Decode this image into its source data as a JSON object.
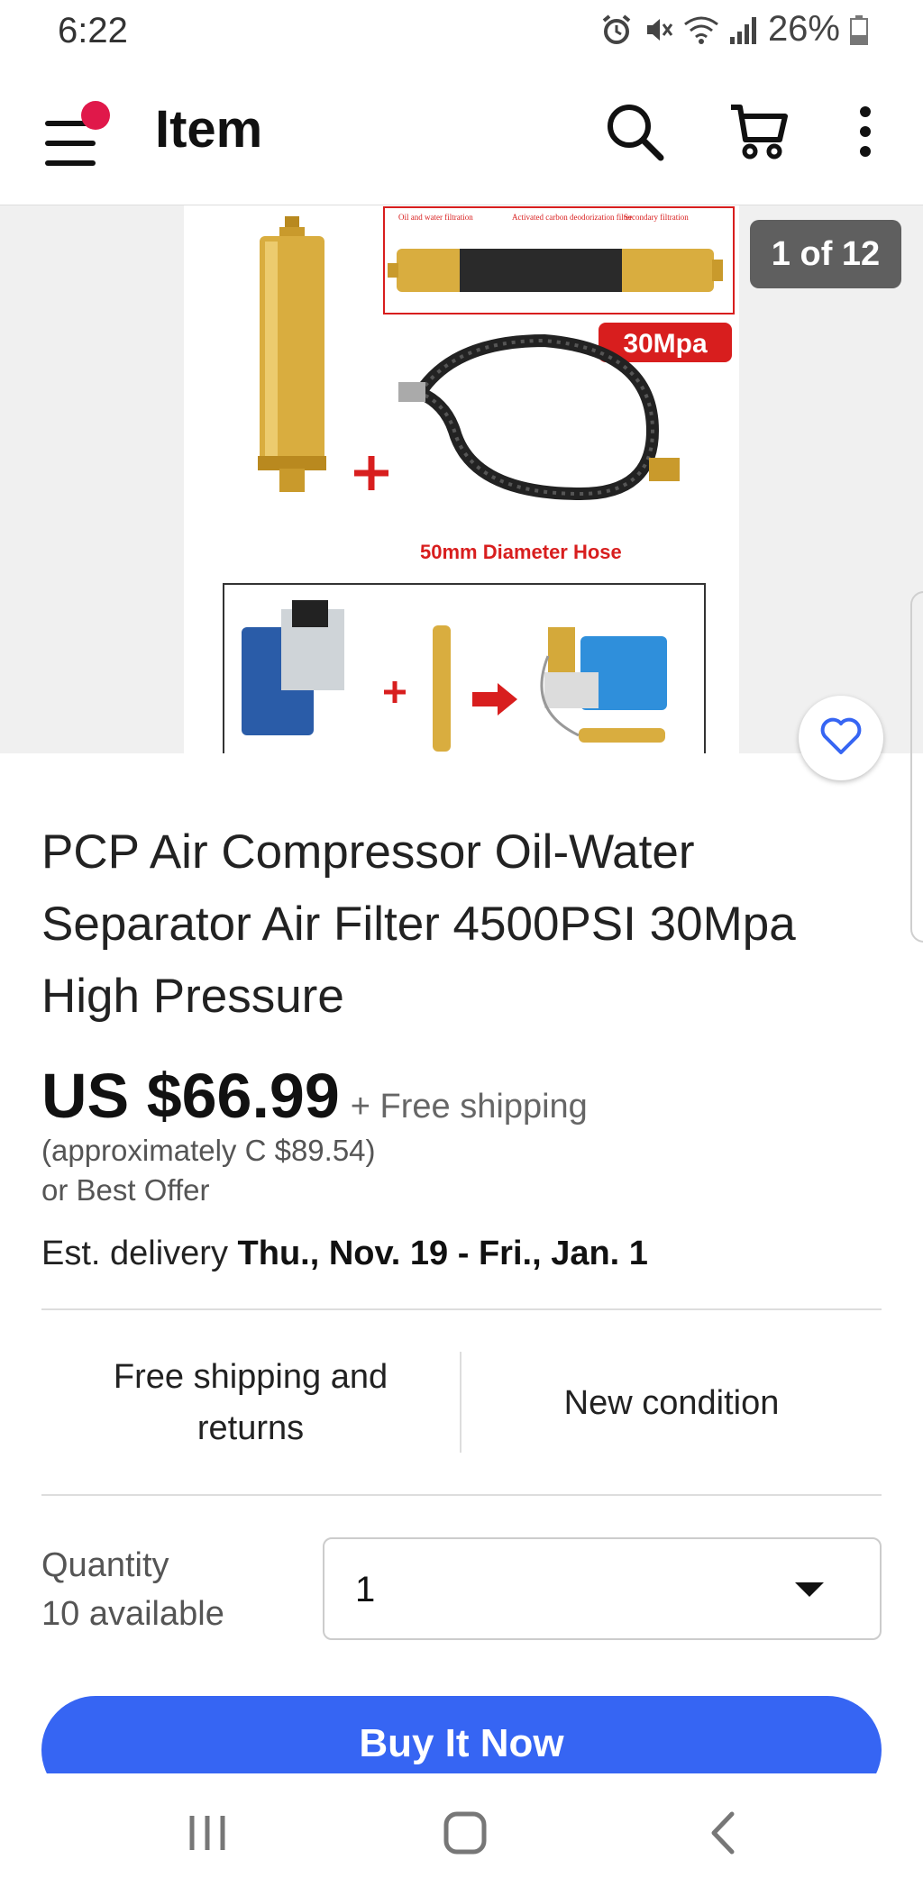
{
  "status_bar": {
    "time": "6:22",
    "battery": "26%",
    "icons": [
      "alarm-icon",
      "mute-icon",
      "wifi-icon",
      "signal-icon",
      "battery-icon"
    ]
  },
  "app_bar": {
    "title": "Item",
    "icons": [
      "menu-icon",
      "search-icon",
      "cart-icon",
      "more-vert-icon"
    ],
    "notification_color": "#e0184a"
  },
  "gallery": {
    "counter": "1 of 12",
    "image_labels": {
      "oil_water": "Oil and water filtration",
      "carbon": "Activated carbon deodorization filter",
      "secondary": "Secondary filtration",
      "pressure": "30Mpa",
      "hose": "50mm Diameter Hose"
    }
  },
  "product": {
    "title": "PCP Air Compressor Oil-Water Separator Air Filter 4500PSI 30Mpa High Pressure",
    "price": "US $66.99",
    "shipping_note": "+ Free shipping",
    "approx_price": "(approximately C $89.54)",
    "best_offer": "or Best Offer",
    "delivery_prefix": "Est. delivery",
    "delivery_dates": "Thu., Nov. 19 - Fri., Jan. 1"
  },
  "features": {
    "shipping": "Free shipping and returns",
    "condition": "New condition"
  },
  "quantity": {
    "label": "Quantity",
    "available": "10 available",
    "selected": "1"
  },
  "actions": {
    "buy_now": "Buy It Now"
  },
  "colors": {
    "primary": "#3665f3",
    "watch_heart": "#3665f3",
    "image_red": "#d81e1e",
    "brass": "#d4a93a"
  }
}
